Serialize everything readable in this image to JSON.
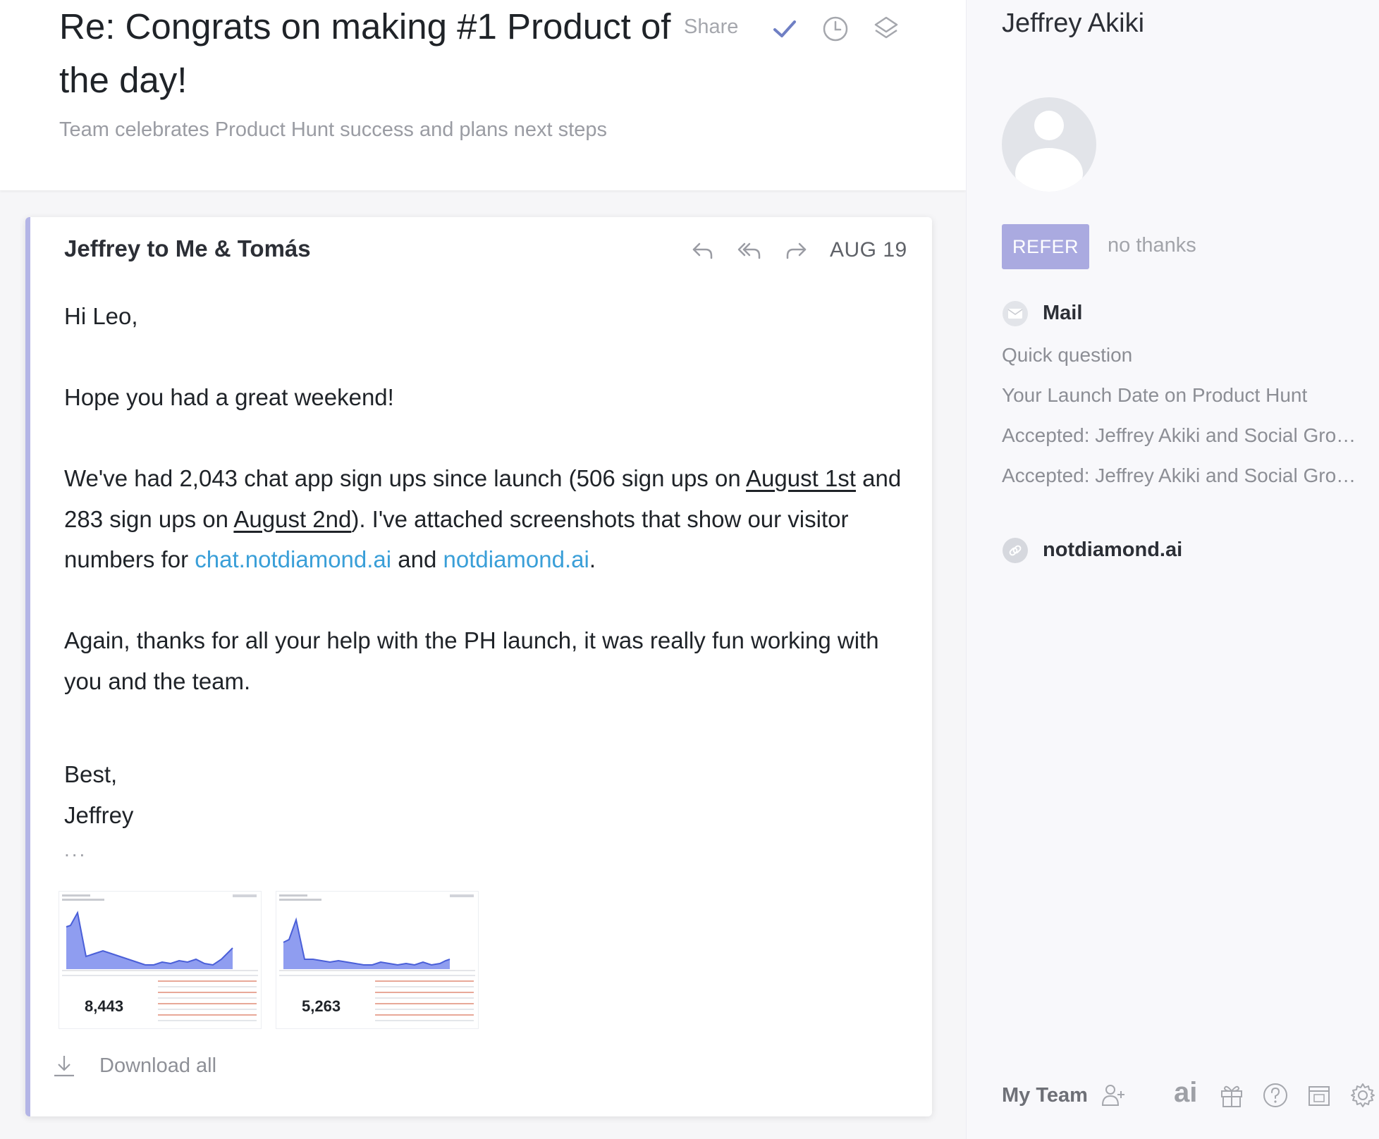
{
  "thread": {
    "subject": "Re: Congrats on making #1 Product of the day!",
    "summary": "Team celebrates Product Hunt success and plans next steps",
    "share_label": "Share"
  },
  "message": {
    "sender_line": "Jeffrey to Me & Tomás",
    "date": "AUG 19",
    "greeting": "Hi Leo,",
    "line1": "Hope you had a great weekend!",
    "p2_a": "We've had 2,043 chat app sign ups since launch (506 sign ups on ",
    "p2_link1": "August 1st",
    "p2_b": " and 283 sign ups on ",
    "p2_link2": "August 2nd",
    "p2_c": "). I've attached screenshots that show our visitor numbers for ",
    "p2_url1": "chat.notdiamond.ai",
    "p2_d": " and ",
    "p2_url2": "notdiamond.ai",
    "p2_e": ".",
    "p3": "Again, thanks for all your help with the PH launch, it was really fun working with you and the team.",
    "signoff": "Best,",
    "signature": "Jeffrey",
    "ellipsis": "...",
    "attachments": [
      {
        "stat": "8,443"
      },
      {
        "stat": "5,263"
      }
    ],
    "download_all": "Download all"
  },
  "sidebar": {
    "contact_name": "Jeffrey Akiki",
    "refer_label": "REFER",
    "no_thanks_label": "no thanks",
    "mail_heading": "Mail",
    "mail_items": [
      "Quick question",
      "Your Launch Date on Product Hunt",
      "Accepted: Jeffrey Akiki and Social Growth",
      "Accepted: Jeffrey Akiki and Social Growth"
    ],
    "link_heading": "notdiamond.ai",
    "my_team_label": "My Team",
    "ai_label": "ai"
  },
  "colors": {
    "accent": "#aaaae0",
    "link": "#3a9fd8",
    "card_border": "#b4b5e6",
    "check": "#6f7fc4"
  }
}
